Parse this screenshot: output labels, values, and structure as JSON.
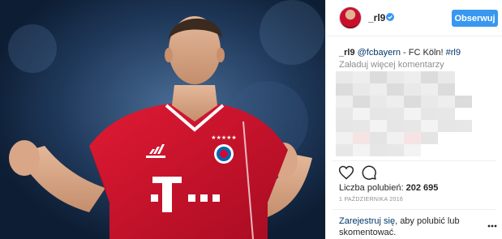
{
  "post": {
    "username": "_rl9",
    "follow_label": "Obserwuj",
    "caption": {
      "user": "_rl9",
      "mention": "@fcbayern",
      "text": " - FC Köln! ",
      "hashtag": "#rl9"
    },
    "load_more_label": "Załaduj więcej komentarzy",
    "likes_label": "Liczba polubień:",
    "likes_count": "202 695",
    "date": "1 PAŹDZIERNIKA 2016",
    "signup_link": "Zarejestruj się",
    "signup_text": ", aby polubić lub skomentować.",
    "icons": [
      "heart-icon",
      "comment-icon",
      "more-options-icon",
      "verified-icon"
    ],
    "colors": {
      "follow_button": "#3897f0",
      "link": "#003569",
      "verified": "#3897f0",
      "jersey": "#c8102e"
    }
  }
}
